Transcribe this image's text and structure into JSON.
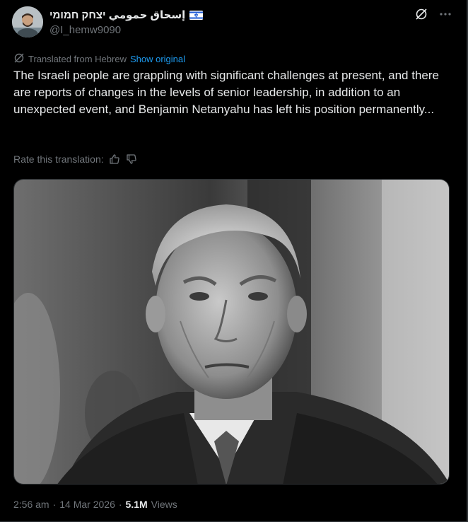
{
  "author": {
    "display_name": "إسحاق حمومي יצחק חמומי",
    "handle": "@I_hemw9090",
    "flag": "israel-flag-icon"
  },
  "translation": {
    "label": "Translated from Hebrew",
    "show_original": "Show original",
    "rate_label": "Rate this translation:"
  },
  "post": {
    "text": "The Israeli people are grappling with significant challenges at present, and there are reports of changes in the levels of senior leadership, in addition to an unexpected event, and Benjamin Netanyahu has left his position permanently..."
  },
  "meta": {
    "time": "2:56 am",
    "separator": "·",
    "date": "14 Mar 2026",
    "views_count": "5.1M",
    "views_label": "Views"
  },
  "icons": {
    "grok": "grok-icon",
    "more": "more-icon",
    "thumbs_up": "thumbs-up-icon",
    "thumbs_down": "thumbs-down-icon",
    "translate": "translate-icon"
  },
  "colors": {
    "background": "#000000",
    "text": "#e7e9ea",
    "muted": "#71767b",
    "link": "#1d9bf0"
  }
}
